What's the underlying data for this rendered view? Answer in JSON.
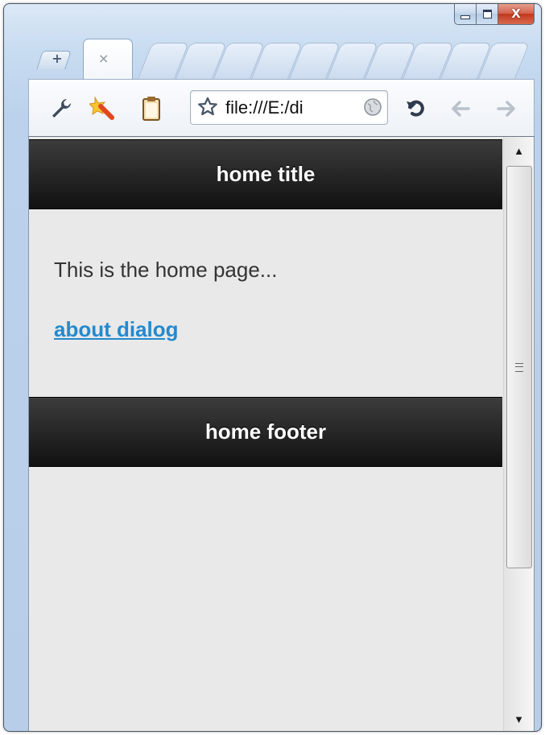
{
  "window": {
    "controls": {
      "close_glyph": "X"
    },
    "close_color": "#c2371c"
  },
  "tabs": {
    "new_tab_glyph": "+",
    "active_tab": {
      "title": "",
      "close_glyph": "×"
    }
  },
  "toolbar": {
    "icons": [
      "wrench-icon",
      "star-burst-extension-icon",
      "clipboard-icon"
    ],
    "address": "file:///E:/di",
    "nav": [
      "reload-icon",
      "back-icon",
      "forward-icon"
    ]
  },
  "page": {
    "header_title": "home title",
    "body_text": "This is the home page...",
    "link_text": "about dialog",
    "footer_title": "home footer",
    "link_color": "#2489ce",
    "bar_color": "#1a1a1a",
    "background": "#e9e9e9"
  },
  "scrollbar": {
    "up_glyph": "▲",
    "down_glyph": "▼"
  }
}
